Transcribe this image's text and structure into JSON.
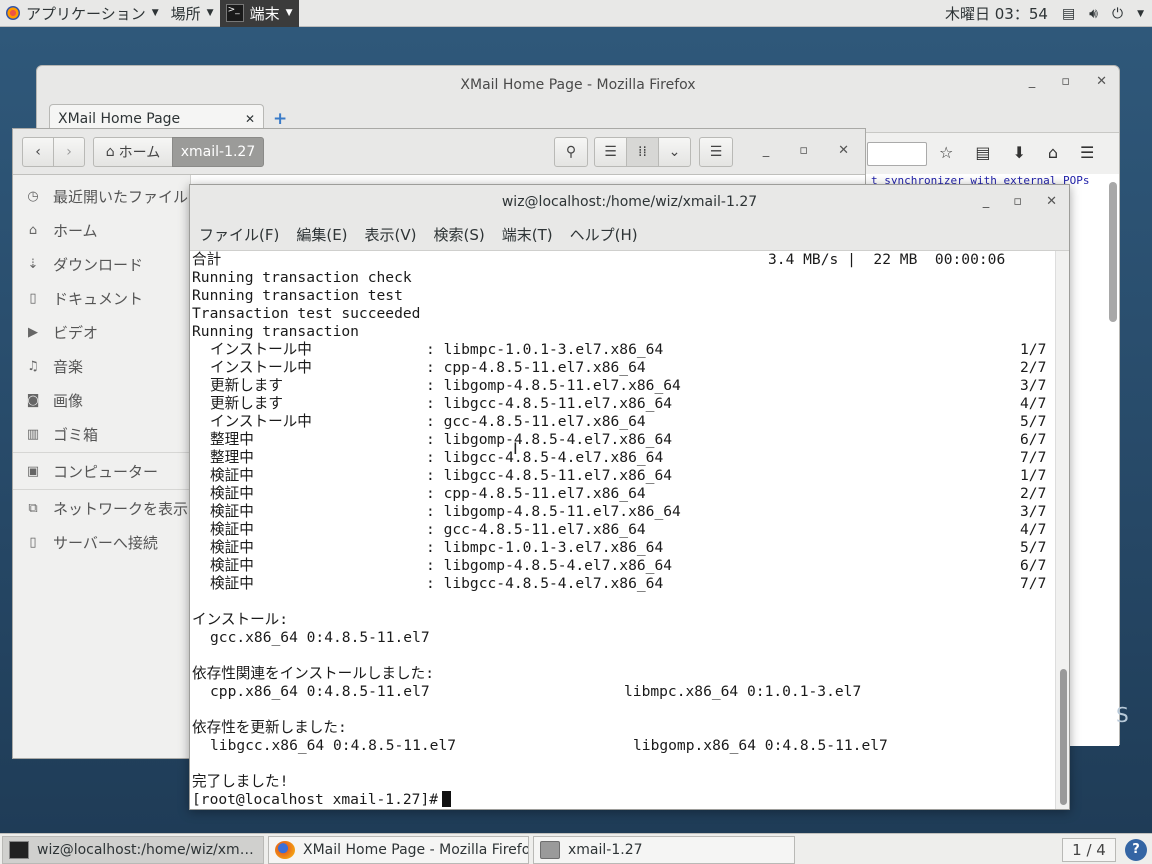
{
  "top_panel": {
    "apps_label": "アプリケーション",
    "places_label": "場所",
    "terminal_label": "端末",
    "clock": "木曜日 03：54"
  },
  "firefox": {
    "title": "XMail Home Page - Mozilla Firefox",
    "tab_label": "XMail Home Page",
    "content_snippet": "t synchronizer with external POPs"
  },
  "files": {
    "path_home": "ホーム",
    "path_current": "xmail-1.27",
    "sidebar": [
      {
        "label": "最近開いたファイル",
        "icon": "clock-icon"
      },
      {
        "label": "ホーム",
        "icon": "home-icon"
      },
      {
        "label": "ダウンロード",
        "icon": "download-icon"
      },
      {
        "label": "ドキュメント",
        "icon": "document-icon"
      },
      {
        "label": "ビデオ",
        "icon": "video-icon"
      },
      {
        "label": "音楽",
        "icon": "music-icon"
      },
      {
        "label": "画像",
        "icon": "camera-icon"
      },
      {
        "label": "ゴミ箱",
        "icon": "trash-icon"
      },
      {
        "label": "コンピューター",
        "icon": "computer-icon"
      },
      {
        "label": "ネットワークを表示",
        "icon": "network-icon"
      },
      {
        "label": "サーバーへ接続",
        "icon": "server-icon"
      }
    ]
  },
  "terminal": {
    "title": "wiz@localhost:/home/wiz/xmail-1.27",
    "menu": [
      "ファイル(F)",
      "編集(E)",
      "表示(V)",
      "検索(S)",
      "端末(T)",
      "ヘルプ(H)"
    ],
    "summary": {
      "label": "合計",
      "stats": "3.4 MB/s |  22 MB  00:00:06"
    },
    "pre_lines": [
      "Running transaction check",
      "Running transaction test",
      "Transaction test succeeded",
      "Running transaction"
    ],
    "transactions": [
      {
        "action": "インストール中",
        "pkg": ": libmpc-1.0.1-3.el7.x86_64",
        "n": "1/7"
      },
      {
        "action": "インストール中",
        "pkg": ": cpp-4.8.5-11.el7.x86_64",
        "n": "2/7"
      },
      {
        "action": "更新します",
        "pkg": ": libgomp-4.8.5-11.el7.x86_64",
        "n": "3/7"
      },
      {
        "action": "更新します",
        "pkg": ": libgcc-4.8.5-11.el7.x86_64",
        "n": "4/7"
      },
      {
        "action": "インストール中",
        "pkg": ": gcc-4.8.5-11.el7.x86_64",
        "n": "5/7"
      },
      {
        "action": "整理中",
        "pkg": ": libgomp-4.8.5-4.el7.x86_64",
        "n": "6/7"
      },
      {
        "action": "整理中",
        "pkg": ": libgcc-4.8.5-4.el7.x86_64",
        "n": "7/7"
      },
      {
        "action": "検証中",
        "pkg": ": libgcc-4.8.5-11.el7.x86_64",
        "n": "1/7"
      },
      {
        "action": "検証中",
        "pkg": ": cpp-4.8.5-11.el7.x86_64",
        "n": "2/7"
      },
      {
        "action": "検証中",
        "pkg": ": libgomp-4.8.5-11.el7.x86_64",
        "n": "3/7"
      },
      {
        "action": "検証中",
        "pkg": ": gcc-4.8.5-11.el7.x86_64",
        "n": "4/7"
      },
      {
        "action": "検証中",
        "pkg": ": libmpc-1.0.1-3.el7.x86_64",
        "n": "5/7"
      },
      {
        "action": "検証中",
        "pkg": ": libgomp-4.8.5-4.el7.x86_64",
        "n": "6/7"
      },
      {
        "action": "検証中",
        "pkg": ": libgcc-4.8.5-4.el7.x86_64",
        "n": "7/7"
      }
    ],
    "installed_header": "インストール:",
    "installed_pkg": "gcc.x86_64 0:4.8.5-11.el7",
    "deps_installed_header": "依存性関連をインストールしました:",
    "deps_installed": [
      "cpp.x86_64 0:4.8.5-11.el7",
      "libmpc.x86_64 0:1.0.1-3.el7"
    ],
    "deps_updated_header": "依存性を更新しました:",
    "deps_updated": [
      "libgcc.x86_64 0:4.8.5-11.el7",
      "libgomp.x86_64 0:4.8.5-11.el7"
    ],
    "complete": "完了しました!",
    "prompt": "[root@localhost xmail-1.27]#"
  },
  "taskbar": {
    "tasks": [
      "wiz@localhost:/home/wiz/xmail-1.27",
      "XMail Home Page - Mozilla Firefox",
      "xmail-1.27"
    ],
    "workspace": "1 / 4",
    "help": "?"
  }
}
